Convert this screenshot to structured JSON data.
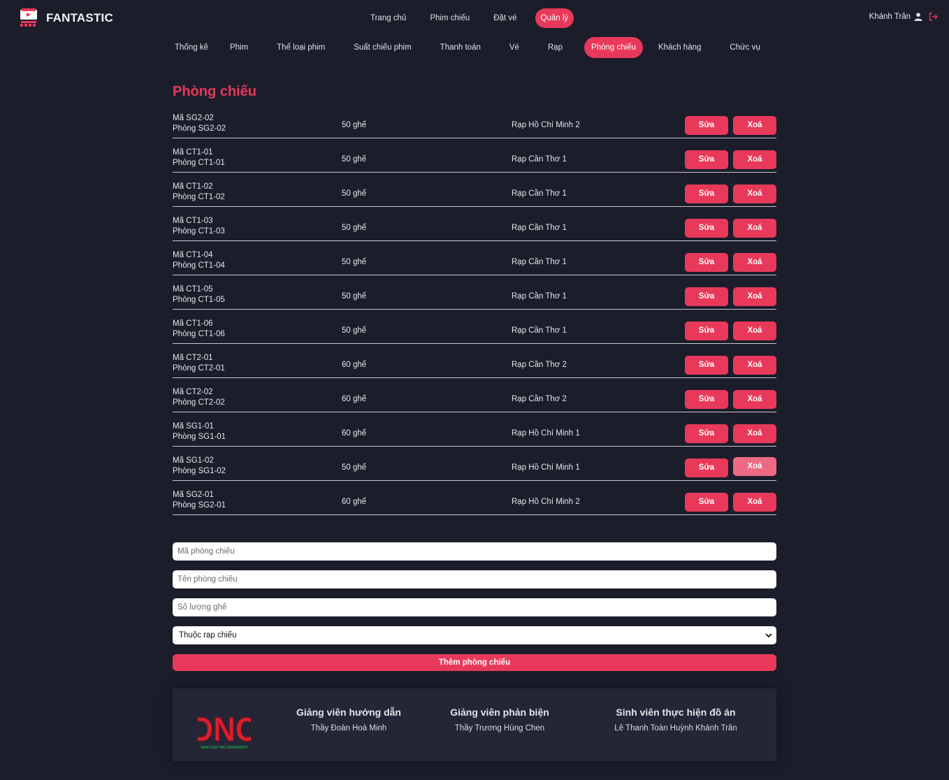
{
  "brand": {
    "name": "FANTASTIC"
  },
  "main_nav": [
    {
      "label": "Trang chủ",
      "active": false
    },
    {
      "label": "Phim chiếu",
      "active": false
    },
    {
      "label": "Đặt vé",
      "active": false
    },
    {
      "label": "Quản lý",
      "active": true
    }
  ],
  "user": {
    "name": "Khánh Trân",
    "user_icon": "user-icon",
    "logout_icon": "logout-icon"
  },
  "sub_nav": [
    {
      "label": "Thống kê",
      "active": false
    },
    {
      "label": "Phim",
      "active": false
    },
    {
      "label": "Thể loại phim",
      "active": false
    },
    {
      "label": "Suất chiếu phim",
      "active": false
    },
    {
      "label": "Thanh toán",
      "active": false
    },
    {
      "label": "Vé",
      "active": false
    },
    {
      "label": "Rạp",
      "active": false
    },
    {
      "label": "Phòng chiếu",
      "active": true
    },
    {
      "label": "Khách hàng",
      "active": false
    },
    {
      "label": "Chức vụ",
      "active": false
    }
  ],
  "page": {
    "title": "Phòng chiếu"
  },
  "rooms": [
    {
      "code": "Mã SG2-02",
      "name": "Phòng SG2-02",
      "seats": "50 ghế",
      "cinema": "Rạp Hồ Chí Minh 2"
    },
    {
      "code": "Mã CT1-01",
      "name": "Phòng CT1-01",
      "seats": "50 ghế",
      "cinema": "Rạp Cần Thơ 1"
    },
    {
      "code": "Mã CT1-02",
      "name": "Phòng CT1-02",
      "seats": "50 ghế",
      "cinema": "Rạp Cần Thơ 1"
    },
    {
      "code": "Mã CT1-03",
      "name": "Phòng CT1-03",
      "seats": "50 ghế",
      "cinema": "Rạp Cần Thơ 1"
    },
    {
      "code": "Mã CT1-04",
      "name": "Phòng CT1-04",
      "seats": "50 ghế",
      "cinema": "Rạp Cần Thơ 1"
    },
    {
      "code": "Mã CT1-05",
      "name": "Phòng CT1-05",
      "seats": "50 ghế",
      "cinema": "Rạp Cần Thơ 1"
    },
    {
      "code": "Mã CT1-06",
      "name": "Phòng CT1-06",
      "seats": "50 ghế",
      "cinema": "Rạp Cần Thơ 1"
    },
    {
      "code": "Mã CT2-01",
      "name": "Phòng CT2-01",
      "seats": "60 ghế",
      "cinema": "Rạp Cần Thơ 2"
    },
    {
      "code": "Mã CT2-02",
      "name": "Phòng CT2-02",
      "seats": "60 ghế",
      "cinema": "Rạp Cần Thơ 2"
    },
    {
      "code": "Mã SG1-01",
      "name": "Phòng SG1-01",
      "seats": "60 ghế",
      "cinema": "Rạp Hồ Chí Minh 1"
    },
    {
      "code": "Mã SG1-02",
      "name": "Phòng SG1-02",
      "seats": "50 ghế",
      "cinema": "Rạp Hồ Chí Minh 1",
      "delete_hovered": true
    },
    {
      "code": "Mã SG2-01",
      "name": "Phòng SG2-01",
      "seats": "60 ghế",
      "cinema": "Rạp Hồ Chí Minh 2"
    }
  ],
  "row_actions": {
    "edit_label": "Sửa",
    "delete_label": "Xoá"
  },
  "form": {
    "code_placeholder": "Mã phòng chiếu",
    "name_placeholder": "Tên phòng chiếu",
    "seats_placeholder": "Số lượng ghế",
    "cinema_select_value": "Thuộc rạp chiếu",
    "submit_label": "Thêm phòng chiếu"
  },
  "footer": {
    "logo_text": "DNC",
    "logo_caption": "NAM CAN THO UNIVERSITY",
    "advisor_heading": "Giảng viên hướng dẫn",
    "advisor_name": "Thầy Đoàn Hoà Minh",
    "reviewer_heading": "Giảng viên phản biện",
    "reviewer_name": "Thầy Trương Hùng Chen",
    "students_heading": "Sinh viên thực hiện đồ án",
    "students_names": "Lê Thanh Toàn Huỳnh Khánh Trân"
  },
  "colors": {
    "background": "#1c1d2b",
    "accent": "#e8395a",
    "footer": "#242636"
  }
}
